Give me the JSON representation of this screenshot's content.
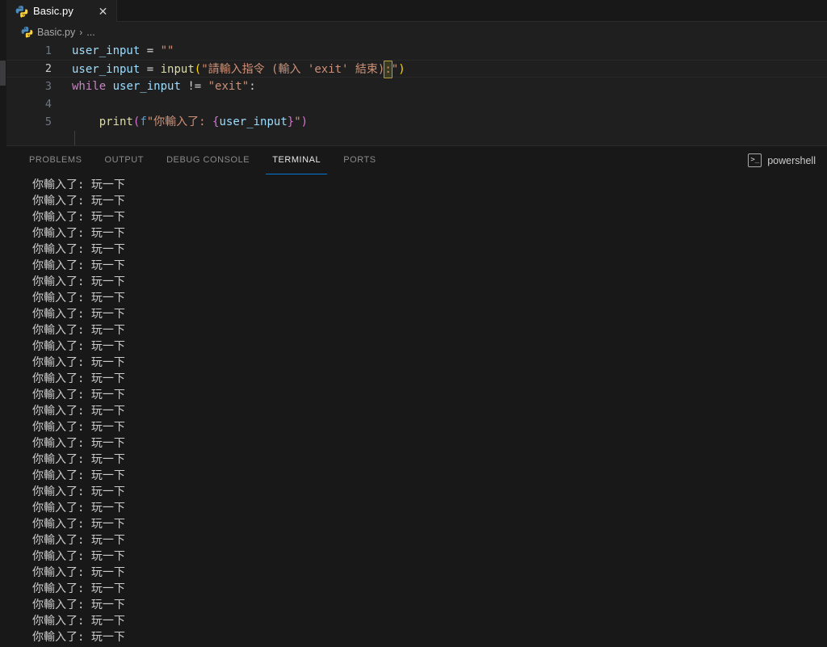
{
  "window": {
    "background": "#1f1f1f",
    "accent": "#0078d4"
  },
  "tabbar": {
    "tabs": [
      {
        "label": "Basic.py",
        "icon": "python-icon",
        "active": true,
        "close_glyph": "✕"
      }
    ]
  },
  "breadcrumb": {
    "icon": "python-icon",
    "file": "Basic.py",
    "separator": "›",
    "trailing": "..."
  },
  "editor": {
    "language": "python",
    "indent_guide": true,
    "active_line": 2,
    "lines": [
      {
        "number": "1",
        "tokens": [
          {
            "text": "user_input",
            "cls": "t-var"
          },
          {
            "text": " ",
            "cls": "t-plain"
          },
          {
            "text": "=",
            "cls": "t-op"
          },
          {
            "text": " ",
            "cls": "t-plain"
          },
          {
            "text": "\"\"",
            "cls": "t-str"
          }
        ]
      },
      {
        "number": "2",
        "tokens": [
          {
            "text": "user_input",
            "cls": "t-var"
          },
          {
            "text": " ",
            "cls": "t-plain"
          },
          {
            "text": "=",
            "cls": "t-op"
          },
          {
            "text": " ",
            "cls": "t-plain"
          },
          {
            "text": "input",
            "cls": "t-fn"
          },
          {
            "text": "(",
            "cls": "t-par1"
          },
          {
            "text": "\"請輸入指令 (輸入 'exit' 結束)",
            "cls": "t-str"
          },
          {
            "text": ":",
            "cls": "t-str",
            "selected": true
          },
          {
            "text": "\"",
            "cls": "t-str"
          },
          {
            "text": ")",
            "cls": "t-par1"
          }
        ]
      },
      {
        "number": "3",
        "tokens": [
          {
            "text": "while",
            "cls": "t-kw"
          },
          {
            "text": " ",
            "cls": "t-plain"
          },
          {
            "text": "user_input",
            "cls": "t-var"
          },
          {
            "text": " ",
            "cls": "t-plain"
          },
          {
            "text": "!=",
            "cls": "t-op"
          },
          {
            "text": " ",
            "cls": "t-plain"
          },
          {
            "text": "\"exit\"",
            "cls": "t-str"
          },
          {
            "text": ":",
            "cls": "t-op"
          }
        ]
      },
      {
        "number": "4",
        "tokens": []
      },
      {
        "number": "5",
        "tokens": [
          {
            "text": "    ",
            "cls": "t-plain"
          },
          {
            "text": "print",
            "cls": "t-fn"
          },
          {
            "text": "(",
            "cls": "t-par2"
          },
          {
            "text": "f",
            "cls": "t-fpfx"
          },
          {
            "text": "\"你輸入了: ",
            "cls": "t-str"
          },
          {
            "text": "{",
            "cls": "t-brace"
          },
          {
            "text": "user_input",
            "cls": "t-var"
          },
          {
            "text": "}",
            "cls": "t-brace"
          },
          {
            "text": "\"",
            "cls": "t-str"
          },
          {
            "text": ")",
            "cls": "t-par2"
          }
        ]
      }
    ]
  },
  "panel": {
    "tabs": [
      {
        "label": "PROBLEMS",
        "active": false
      },
      {
        "label": "OUTPUT",
        "active": false
      },
      {
        "label": "DEBUG CONSOLE",
        "active": false
      },
      {
        "label": "TERMINAL",
        "active": true
      },
      {
        "label": "PORTS",
        "active": false
      }
    ],
    "shell": {
      "icon": "terminal-icon",
      "icon_glyph": "&gt;_",
      "label": "powershell"
    },
    "terminal": {
      "output_line": "你輸入了: 玩一下",
      "line_count": 29
    }
  }
}
